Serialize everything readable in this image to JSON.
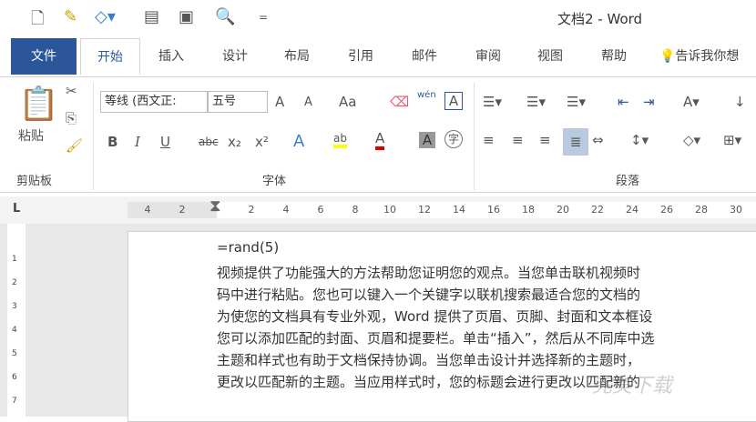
{
  "window": {
    "title": "文档2 - Word"
  },
  "qat": {
    "more": "="
  },
  "tabs": [
    "文件",
    "开始",
    "插入",
    "设计",
    "布局",
    "引用",
    "邮件",
    "审阅",
    "视图",
    "帮助"
  ],
  "tell_me": "告诉我你想",
  "clipboard": {
    "paste": "粘贴",
    "group": "剪贴板"
  },
  "font": {
    "name": "等线 (西文正:",
    "size": "五号",
    "grow": "A",
    "shrink": "A",
    "case": "Aa",
    "pinyin": "wén",
    "border": "A",
    "bold": "B",
    "italic": "I",
    "underline": "U",
    "strike": "abc",
    "sub": "x₂",
    "sup": "x²",
    "effects": "A",
    "highlight": "ab",
    "color": "A",
    "shade": "A",
    "enclose": "字",
    "group": "字体"
  },
  "paragraph": {
    "group": "段落"
  },
  "ruler": {
    "corner": "L",
    "ticks": [
      "4",
      "2",
      "2",
      "4",
      "6",
      "8",
      "10",
      "12",
      "14",
      "16",
      "18",
      "20",
      "22",
      "24",
      "26",
      "28",
      "30"
    ]
  },
  "vruler": [
    "1",
    "2",
    "3",
    "4",
    "5",
    "6",
    "7"
  ],
  "document": {
    "lines": [
      "=rand(5)",
      "视频提供了功能强大的方法帮助您证明您的观点。当您单击联机视频时",
      "码中进行粘贴。您也可以键入一个关键字以联机搜索最适合您的文档的",
      "为使您的文档具有专业外观，Word 提供了页眉、页脚、封面和文本框设",
      "您可以添加匹配的封面、页眉和提要栏。单击“插入”，然后从不同库中选",
      "主题和样式也有助于文档保持协调。当您单击设计并选择新的主题时，",
      "更改以匹配新的主题。当应用样式时，您的标题会进行更改以匹配新的"
    ]
  },
  "watermark": "完美下载",
  "colors": {
    "accent": "#2b579a",
    "highlight": "#ffff00",
    "font_color": "#e00000"
  }
}
